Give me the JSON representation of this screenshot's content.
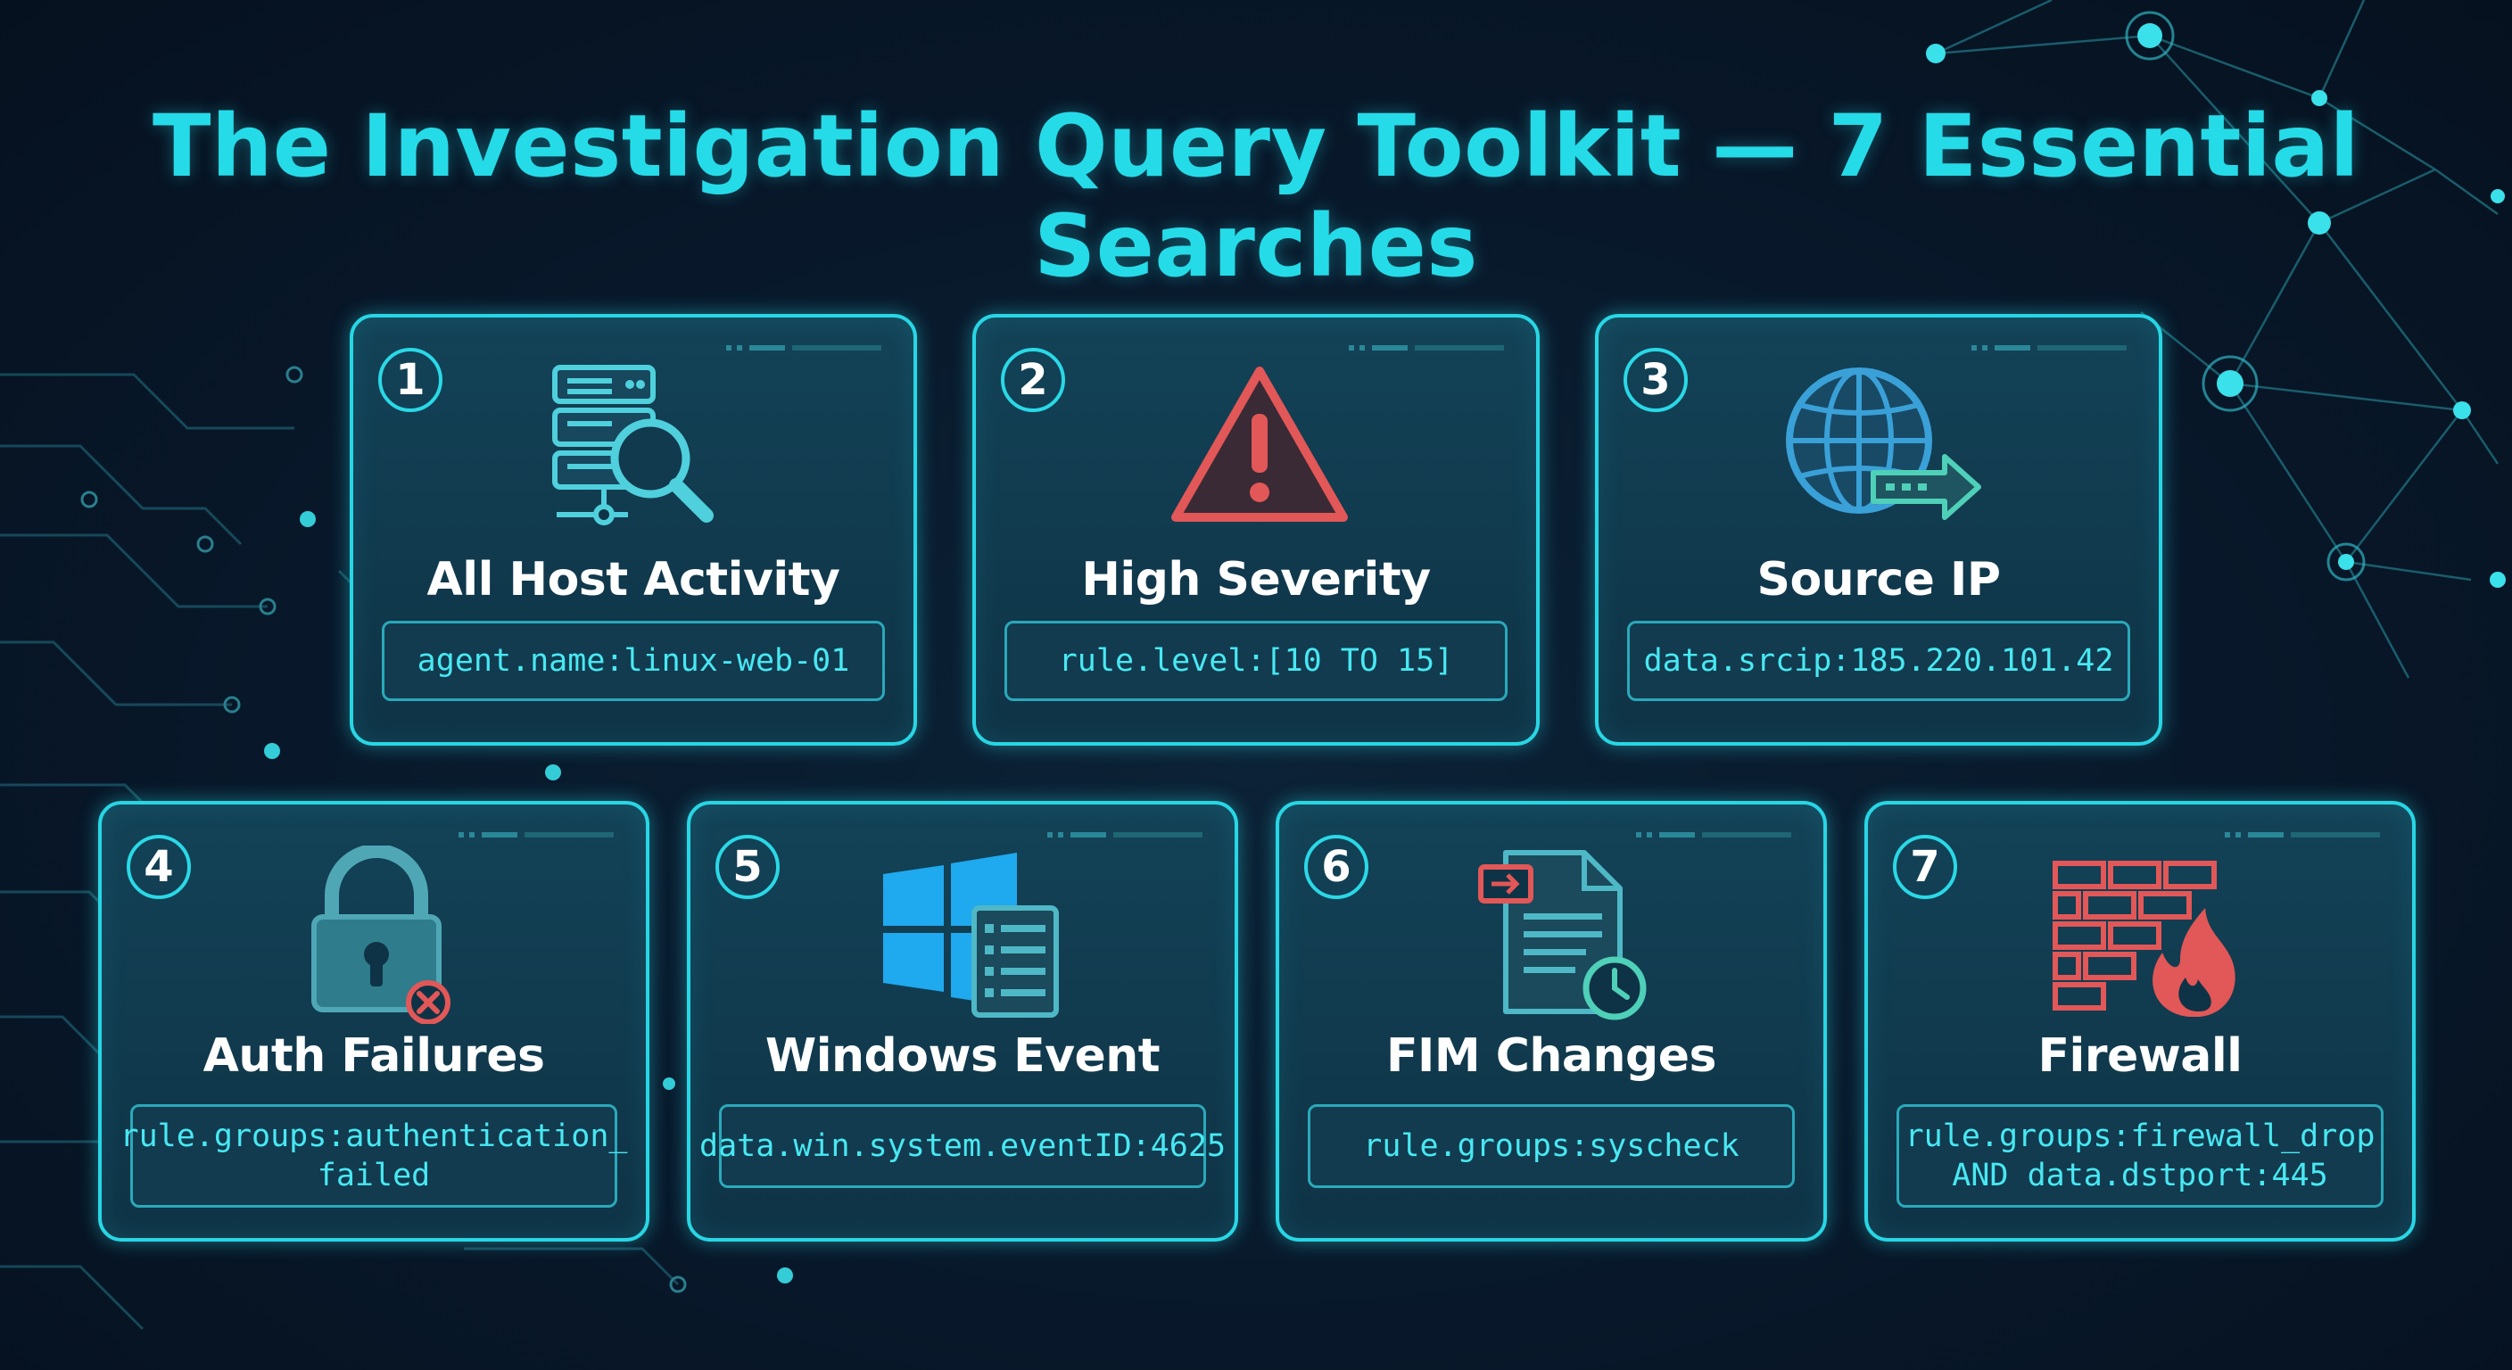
{
  "title": "The Investigation Query Toolkit — 7 Essential Searches",
  "colors": {
    "accent": "#25dbe8",
    "card_border": "#28d6e4",
    "query_text": "#48e8f2",
    "alert_red": "#e05555",
    "windows_blue": "#1fa9ee"
  },
  "cards": [
    {
      "number": "1",
      "label": "All Host Activity",
      "query": "agent.name:linux-web-01",
      "icon": "server-search-icon"
    },
    {
      "number": "2",
      "label": "High Severity",
      "query": "rule.level:[10 TO 15]",
      "icon": "warning-triangle-icon"
    },
    {
      "number": "3",
      "label": "Source IP",
      "query": "data.srcip:185.220.101.42",
      "icon": "globe-arrow-icon"
    },
    {
      "number": "4",
      "label": "Auth Failures",
      "query": "rule.groups:authentication_\nfailed",
      "icon": "padlock-error-icon"
    },
    {
      "number": "5",
      "label": "Windows Event",
      "query": "data.win.system.eventID:4625",
      "icon": "windows-log-icon"
    },
    {
      "number": "6",
      "label": "FIM Changes",
      "query": "rule.groups:syscheck",
      "icon": "file-clock-icon"
    },
    {
      "number": "7",
      "label": "Firewall",
      "query": "rule.groups:firewall_drop\nAND data.dstport:445",
      "icon": "firewall-flame-icon"
    }
  ]
}
